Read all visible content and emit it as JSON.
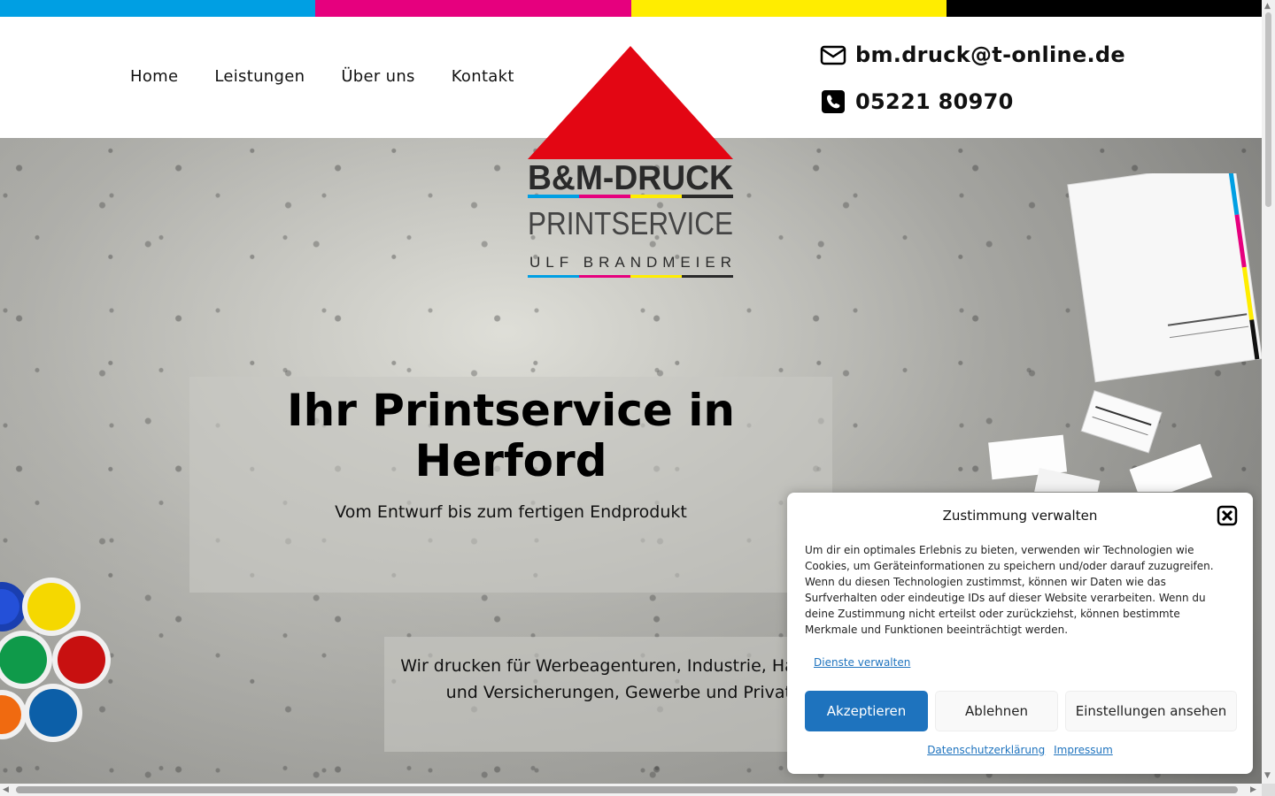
{
  "colors": {
    "cyan": "#009fe3",
    "magenta": "#e6007e",
    "yellow": "#ffed00",
    "key": "#000000",
    "logo_red": "#e30613",
    "accent_blue": "#1e73be"
  },
  "nav": {
    "items": [
      {
        "label": "Home"
      },
      {
        "label": "Leistungen"
      },
      {
        "label": "Über uns"
      },
      {
        "label": "Kontakt"
      }
    ]
  },
  "contact": {
    "email": "bm.druck@t-online.de",
    "email_icon": "envelope-icon",
    "phone": "05221 80970",
    "phone_icon": "phone-icon"
  },
  "logo": {
    "line1": "B&M-DRUCK",
    "line2": "PRINTSERVICE",
    "line3": "ULF BRANDMEIER"
  },
  "hero": {
    "title": "Ihr Printservice in Herford",
    "subtitle": "Vom Entwurf bis zum fertigen Endprodukt",
    "text": "Wir drucken für Werbeagenturen, Industrie, Handel, Banken und Versicherungen, Gewerbe und Privatkunden."
  },
  "cookie": {
    "title": "Zustimmung verwalten",
    "close_icon": "close-icon",
    "text": "Um dir ein optimales Erlebnis zu bieten, verwenden wir Technologien wie Cookies, um Geräteinformationen zu speichern und/oder darauf zuzugreifen. Wenn du diesen Technologien zustimmst, können wir Daten wie das Surfverhalten oder eindeutige IDs auf dieser Website verarbeiten. Wenn du deine Zustimmung nicht erteilst oder zurückziehst, können bestimmte Merkmale und Funktionen beeinträchtigt werden.",
    "manage_link": "Dienste verwalten",
    "accept": "Akzeptieren",
    "deny": "Ablehnen",
    "settings": "Einstellungen ansehen",
    "privacy_link": "Datenschutzerklärung",
    "imprint_link": "Impressum"
  }
}
